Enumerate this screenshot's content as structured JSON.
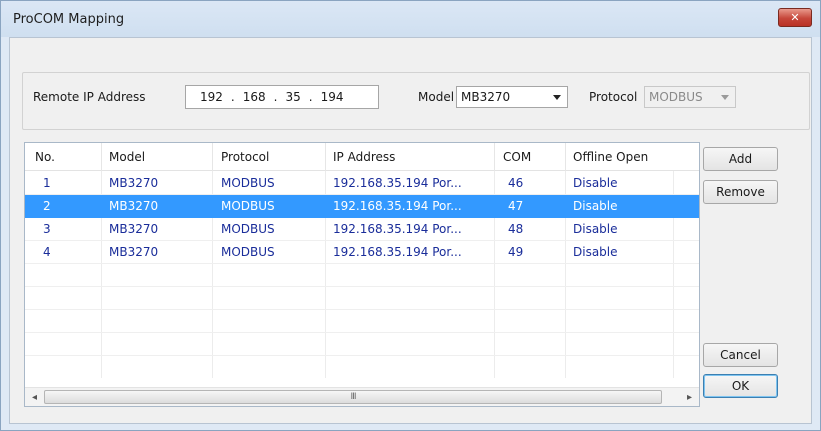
{
  "window": {
    "title": "ProCOM Mapping",
    "close_glyph": "✕"
  },
  "connection": {
    "remote_ip_label": "Remote IP Address",
    "ip_octets": [
      "192",
      "168",
      "35",
      "194"
    ],
    "ip_separator": ".",
    "model_label": "Model",
    "model_value": "MB3270",
    "protocol_label": "Protocol",
    "protocol_value": "MODBUS"
  },
  "table": {
    "columns": [
      "No.",
      "Model",
      "Protocol",
      "IP Address",
      "COM",
      "Offline Open"
    ],
    "rows": [
      {
        "no": "1",
        "model": "MB3270",
        "protocol": "MODBUS",
        "ip": "192.168.35.194 Por...",
        "com": "46",
        "offline": "Disable",
        "selected": false
      },
      {
        "no": "2",
        "model": "MB3270",
        "protocol": "MODBUS",
        "ip": "192.168.35.194 Por...",
        "com": "47",
        "offline": "Disable",
        "selected": true
      },
      {
        "no": "3",
        "model": "MB3270",
        "protocol": "MODBUS",
        "ip": "192.168.35.194 Por...",
        "com": "48",
        "offline": "Disable",
        "selected": false
      },
      {
        "no": "4",
        "model": "MB3270",
        "protocol": "MODBUS",
        "ip": "192.168.35.194 Por...",
        "com": "49",
        "offline": "Disable",
        "selected": false
      }
    ],
    "scroll_left_glyph": "◂",
    "scroll_right_glyph": "▸",
    "thumb_grip": "III"
  },
  "buttons": {
    "add": "Add",
    "remove": "Remove",
    "cancel": "Cancel",
    "ok": "OK"
  },
  "colors": {
    "selection": "#3399ff",
    "row_text": "#1a2d9a",
    "close_button": "#c6463a"
  }
}
